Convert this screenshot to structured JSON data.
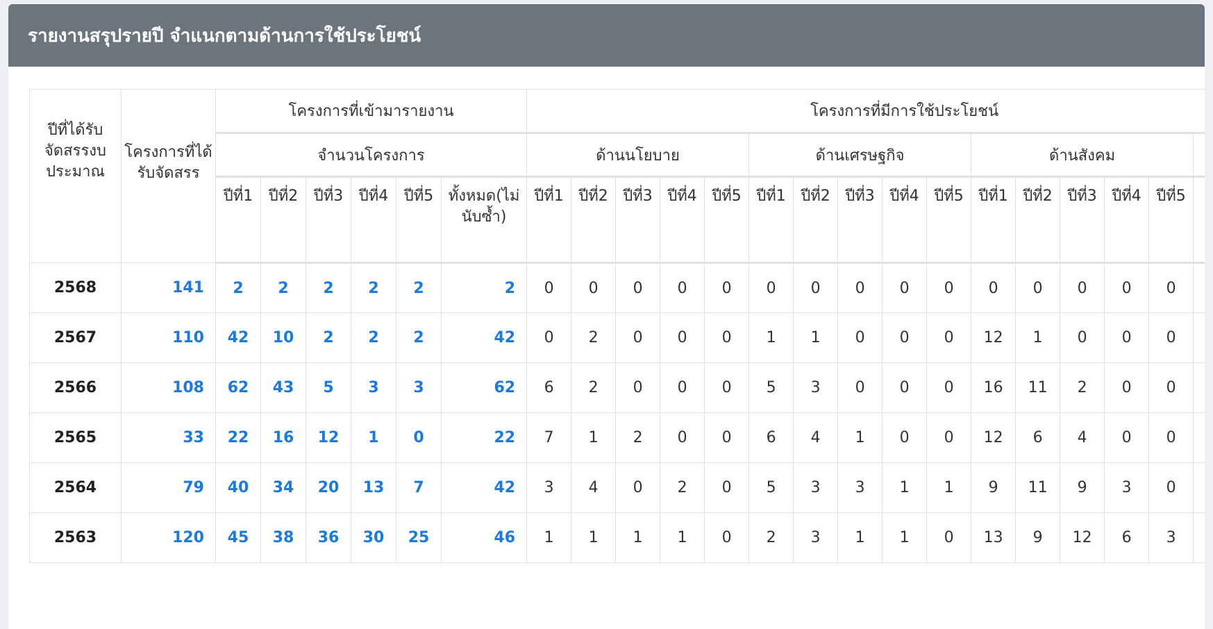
{
  "title": "รายงานสรุปรายปี จำแนกตามด้านการใช้ประโยชน์",
  "headers": {
    "year": "ปีที่ได้รับจัดสรรงบประมาณ",
    "allocated": "โครงการที่ได้รับจัดสรร",
    "reported_group": "โครงการที่เข้ามารายงาน",
    "benefit_group": "โครงการที่มีการใช้ประโยชน์",
    "project_count": "จำนวนโครงการ",
    "policy": "ด้านนโยบาย",
    "economic": "ด้านเศรษฐกิจ",
    "social": "ด้านสังคม",
    "year_cols": [
      "ปีที่1",
      "ปีที่2",
      "ปีที่3",
      "ปีที่4",
      "ปีที่5"
    ],
    "total_nodup": "ทั้งหมด(ไม่นับซ้ำ)"
  },
  "rows": [
    {
      "year": "2568",
      "allocated": "141",
      "reported": [
        "2",
        "2",
        "2",
        "2",
        "2"
      ],
      "total": "2",
      "policy": [
        "0",
        "0",
        "0",
        "0",
        "0"
      ],
      "economic": [
        "0",
        "0",
        "0",
        "0",
        "0"
      ],
      "social": [
        "0",
        "0",
        "0",
        "0",
        "0"
      ]
    },
    {
      "year": "2567",
      "allocated": "110",
      "reported": [
        "42",
        "10",
        "2",
        "2",
        "2"
      ],
      "total": "42",
      "policy": [
        "0",
        "2",
        "0",
        "0",
        "0"
      ],
      "economic": [
        "1",
        "1",
        "0",
        "0",
        "0"
      ],
      "social": [
        "12",
        "1",
        "0",
        "0",
        "0"
      ]
    },
    {
      "year": "2566",
      "allocated": "108",
      "reported": [
        "62",
        "43",
        "5",
        "3",
        "3"
      ],
      "total": "62",
      "policy": [
        "6",
        "2",
        "0",
        "0",
        "0"
      ],
      "economic": [
        "5",
        "3",
        "0",
        "0",
        "0"
      ],
      "social": [
        "16",
        "11",
        "2",
        "0",
        "0"
      ]
    },
    {
      "year": "2565",
      "allocated": "33",
      "reported": [
        "22",
        "16",
        "12",
        "1",
        "0"
      ],
      "total": "22",
      "policy": [
        "7",
        "1",
        "2",
        "0",
        "0"
      ],
      "economic": [
        "6",
        "4",
        "1",
        "0",
        "0"
      ],
      "social": [
        "12",
        "6",
        "4",
        "0",
        "0"
      ]
    },
    {
      "year": "2564",
      "allocated": "79",
      "reported": [
        "40",
        "34",
        "20",
        "13",
        "7"
      ],
      "total": "42",
      "policy": [
        "3",
        "4",
        "0",
        "2",
        "0"
      ],
      "economic": [
        "5",
        "3",
        "3",
        "1",
        "1"
      ],
      "social": [
        "9",
        "11",
        "9",
        "3",
        "0"
      ]
    },
    {
      "year": "2563",
      "allocated": "120",
      "reported": [
        "45",
        "38",
        "36",
        "30",
        "25"
      ],
      "total": "46",
      "policy": [
        "1",
        "1",
        "1",
        "1",
        "0"
      ],
      "economic": [
        "2",
        "3",
        "1",
        "1",
        "0"
      ],
      "social": [
        "13",
        "9",
        "12",
        "6",
        "3"
      ]
    }
  ]
}
